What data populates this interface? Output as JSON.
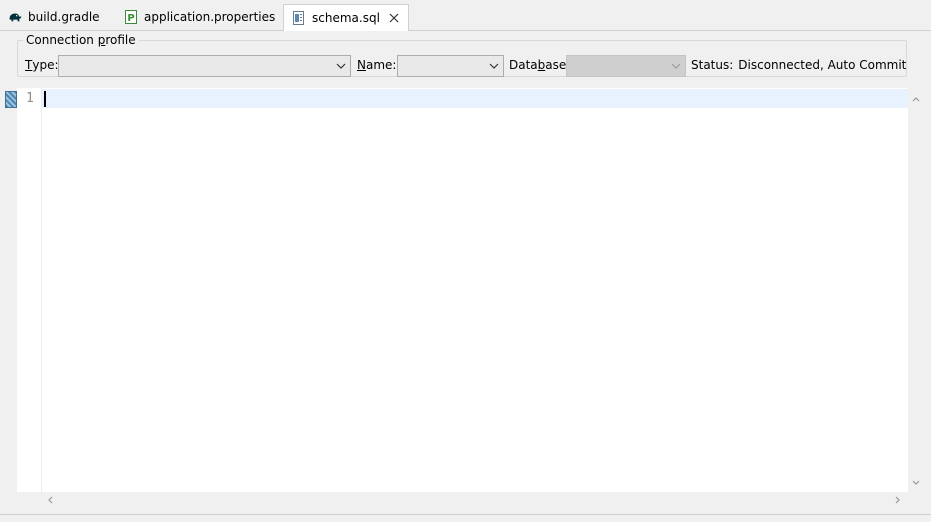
{
  "tabs": [
    {
      "label": "build.gradle",
      "icon": "gradle-elephant-icon",
      "active": false
    },
    {
      "label": "application.properties",
      "icon": "properties-file-icon",
      "icon_letter": "P",
      "active": false
    },
    {
      "label": "schema.sql",
      "icon": "sql-file-icon",
      "active": true
    }
  ],
  "connection": {
    "group_label_pre": "Connection ",
    "group_label_u": "p",
    "group_label_post": "rofile",
    "type_label_u": "T",
    "type_label_post": "ype:",
    "type_value": "",
    "name_label_u": "N",
    "name_label_post": "ame:",
    "name_value": "",
    "database_label_pre": "Data",
    "database_label_u": "b",
    "database_label_post": "ase:",
    "database_value": "",
    "status_label": "Status:",
    "status_value": "Disconnected, Auto Commit"
  },
  "editor": {
    "line_number": "1",
    "content": ""
  },
  "colors": {
    "current_line": "#e8f2fe",
    "tab_active_bg": "#ffffff",
    "gradle_icon": "#02303a",
    "properties_icon": "#3a8c3a"
  }
}
